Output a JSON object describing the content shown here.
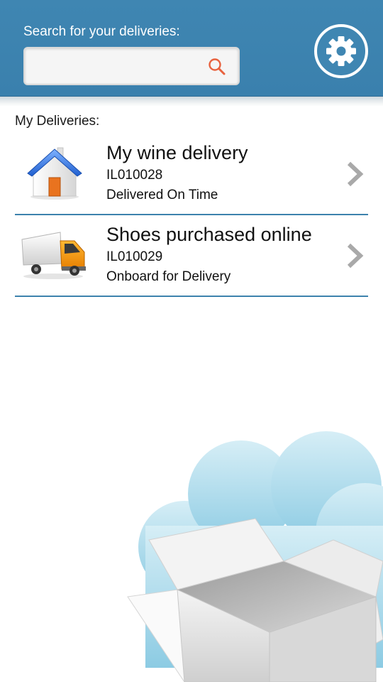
{
  "search": {
    "label": "Search for your deliveries:",
    "value": "",
    "placeholder": ""
  },
  "icons": {
    "search": "search-icon",
    "settings": "gear-icon",
    "row_arrow": "chevron-right-icon",
    "house": "house-icon",
    "truck": "truck-icon"
  },
  "list": {
    "title": "My Deliveries:",
    "items": [
      {
        "title": "My wine delivery",
        "id": "IL010028",
        "status": "Delivered On Time",
        "icon": "house-icon"
      },
      {
        "title": "Shoes purchased online",
        "id": "IL010029",
        "status": "Onboard for Delivery",
        "icon": "truck-icon"
      }
    ]
  },
  "colors": {
    "header": "#3f86b2",
    "divider": "#3d82ad",
    "search_icon": "#e8623f",
    "cloud": "#a6d8ea"
  }
}
